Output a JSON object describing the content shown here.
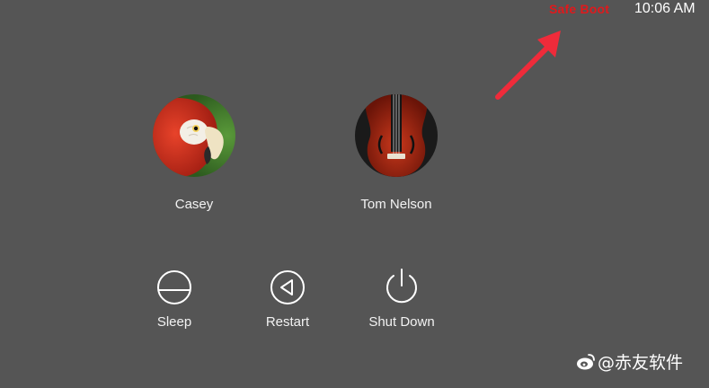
{
  "status": {
    "safe_boot": "Safe Boot",
    "time": "10:06 AM",
    "safe_boot_color": "#e0191c"
  },
  "users": [
    {
      "name": "Casey",
      "avatar": "parrot-avatar"
    },
    {
      "name": "Tom Nelson",
      "avatar": "violin-avatar"
    }
  ],
  "power": {
    "sleep": {
      "label": "Sleep",
      "icon": "sleep-icon"
    },
    "restart": {
      "label": "Restart",
      "icon": "restart-icon"
    },
    "shutdown": {
      "label": "Shut Down",
      "icon": "power-icon"
    }
  },
  "watermark": {
    "text": "@赤友软件",
    "icon": "weibo-logo-icon"
  },
  "annotation": {
    "icon": "red-arrow-icon",
    "color": "#ef2b3a"
  }
}
